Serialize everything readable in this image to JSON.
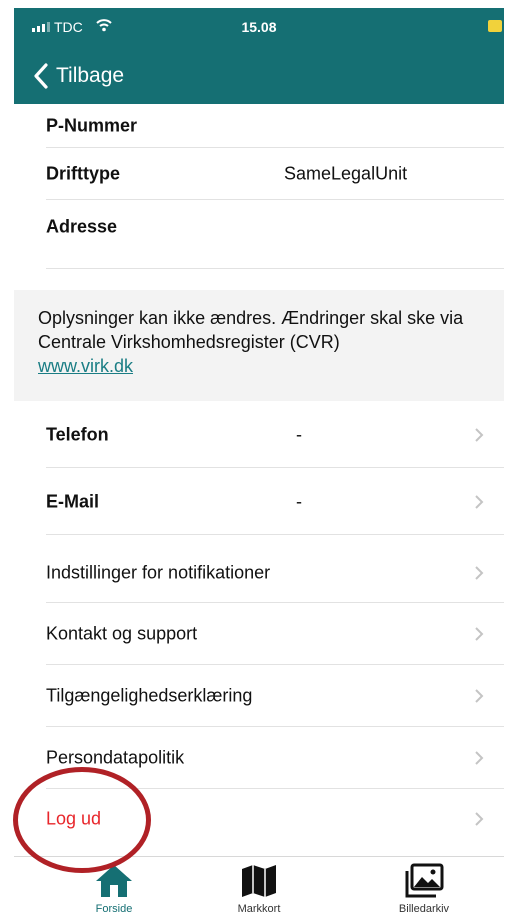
{
  "status_bar": {
    "carrier": "TDC",
    "time": "15.08",
    "icons": [
      "signal-icon",
      "wifi-icon",
      "battery-icon"
    ]
  },
  "nav": {
    "back_label": "Tilbage",
    "back_icon": "chevron-left-icon"
  },
  "info_rows": [
    {
      "label": "P-Nummer",
      "value": ""
    },
    {
      "label": "Drifttype",
      "value": "SameLegalUnit"
    },
    {
      "label": "Adresse",
      "value": ""
    }
  ],
  "notice": {
    "text": "Oplysninger kan ikke ændres. Ændringer skal ske via Centrale Virkshomhedsregister (CVR)",
    "link": "www.virk.dk"
  },
  "contact_rows": [
    {
      "label": "Telefon",
      "value": "-"
    },
    {
      "label": "E-Mail",
      "value": "-"
    }
  ],
  "menu": {
    "notifications": "Indstillinger for notifikationer",
    "support": "Kontakt og support",
    "accessibility": "Tilgængelighedserklæring",
    "privacy": "Persondatapolitik",
    "logout": "Log ud"
  },
  "tabs": [
    {
      "label": "Forside",
      "icon": "home-icon",
      "active": true
    },
    {
      "label": "Markkort",
      "icon": "map-icon",
      "active": false
    },
    {
      "label": "Billedarkiv",
      "icon": "photo-icon",
      "active": false
    }
  ],
  "colors": {
    "header": "#156f73",
    "accent": "#1a7d84",
    "logout": "#e8262b",
    "highlight_ring": "#b02126",
    "chevron": "#c4c4c4"
  }
}
